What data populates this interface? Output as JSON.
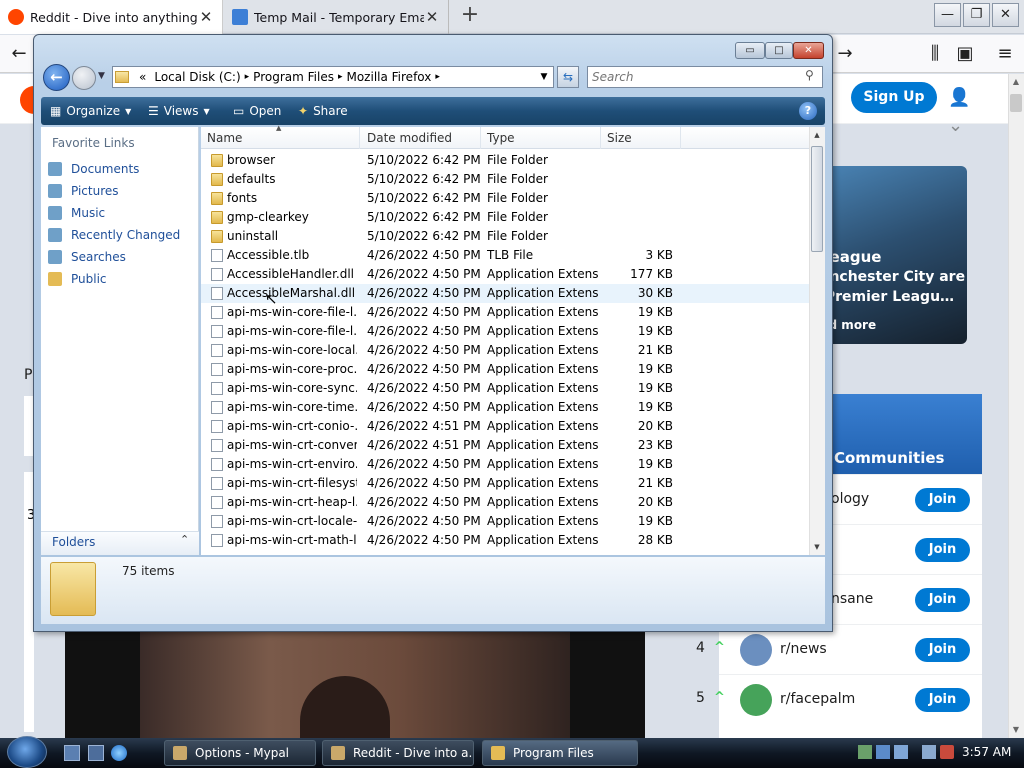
{
  "browser": {
    "tabs": [
      {
        "title": "Reddit - Dive into anything",
        "favicon_color": "#ff4500",
        "active": true
      },
      {
        "title": "Temp Mail - Temporary Email",
        "favicon_color": "#3d7fd6",
        "active": false
      }
    ],
    "new_tab_symbol": "+",
    "window_buttons": {
      "minimize": "—",
      "restore": "❐",
      "close": "✕"
    },
    "nav": {
      "back": "←",
      "forward": "→",
      "library": "⫼",
      "sidebar": "▣",
      "menu": "≡"
    }
  },
  "reddit": {
    "signup_label": "Sign Up",
    "brand_color": "#ff4500",
    "accent_color": "#0079d3",
    "side_letter": "P",
    "side_number": "3",
    "featured": {
      "title": "League",
      "text": "anchester City are\n Premier Leagu…",
      "more": "nd more"
    },
    "communities": {
      "title": "g Communities",
      "rows": [
        {
          "rank": "",
          "name": "ology",
          "icon_color": "#ffffff"
        },
        {
          "rank": "",
          "name": "",
          "icon_color": "#ffffff"
        },
        {
          "rank": "",
          "name": "nsane",
          "icon_color": "#ffffff"
        },
        {
          "rank": "4",
          "name": "r/news",
          "icon_color": "#6b8fbf"
        },
        {
          "rank": "5",
          "name": "r/facepalm",
          "icon_color": "#46a35a"
        }
      ],
      "join_label": "Join",
      "up_arrow": "^"
    }
  },
  "explorer": {
    "caption_buttons": {
      "minimize": "▭",
      "maximize": "□",
      "close": "✕"
    },
    "back_symbol": "←",
    "address": {
      "chevron": "«",
      "segments": [
        "Local Disk (C:)",
        "Program Files",
        "Mozilla Firefox"
      ],
      "separator": "▸"
    },
    "refresh_symbol": "⇆",
    "search_placeholder": "Search",
    "commands": [
      {
        "label": "Organize",
        "icon": "organize-icon",
        "dropdown": true
      },
      {
        "label": "Views",
        "icon": "views-icon",
        "dropdown": true
      },
      {
        "label": "Open",
        "icon": "open-icon",
        "dropdown": false
      },
      {
        "label": "Share",
        "icon": "share-icon",
        "dropdown": false
      }
    ],
    "help_symbol": "?",
    "favorite_links_title": "Favorite Links",
    "favorite_links": [
      {
        "label": "Documents",
        "icon": "documents-icon",
        "color": "#6fa0c8"
      },
      {
        "label": "Pictures",
        "icon": "pictures-icon",
        "color": "#6fa0c8"
      },
      {
        "label": "Music",
        "icon": "music-icon",
        "color": "#6fa0c8"
      },
      {
        "label": "Recently Changed",
        "icon": "recent-icon",
        "color": "#6fa0c8"
      },
      {
        "label": "Searches",
        "icon": "searches-icon",
        "color": "#6fa0c8"
      },
      {
        "label": "Public",
        "icon": "public-folder-icon",
        "color": "#e4bb55"
      }
    ],
    "folders_label": "Folders",
    "folders_toggle": "⌃",
    "columns": [
      "Name",
      "Date modified",
      "Type",
      "Size"
    ],
    "files": [
      {
        "name": "browser",
        "date": "5/10/2022 6:42 PM",
        "type": "File Folder",
        "size": "",
        "kind": "folder"
      },
      {
        "name": "defaults",
        "date": "5/10/2022 6:42 PM",
        "type": "File Folder",
        "size": "",
        "kind": "folder"
      },
      {
        "name": "fonts",
        "date": "5/10/2022 6:42 PM",
        "type": "File Folder",
        "size": "",
        "kind": "folder"
      },
      {
        "name": "gmp-clearkey",
        "date": "5/10/2022 6:42 PM",
        "type": "File Folder",
        "size": "",
        "kind": "folder"
      },
      {
        "name": "uninstall",
        "date": "5/10/2022 6:42 PM",
        "type": "File Folder",
        "size": "",
        "kind": "folder"
      },
      {
        "name": "Accessible.tlb",
        "date": "4/26/2022 4:50 PM",
        "type": "TLB File",
        "size": "3 KB",
        "kind": "file"
      },
      {
        "name": "AccessibleHandler.dll",
        "date": "4/26/2022 4:50 PM",
        "type": "Application Extens...",
        "size": "177 KB",
        "kind": "dll"
      },
      {
        "name": "AccessibleMarshal.dll",
        "date": "4/26/2022 4:50 PM",
        "type": "Application Extens...",
        "size": "30 KB",
        "kind": "dll"
      },
      {
        "name": "api-ms-win-core-file-l...",
        "date": "4/26/2022 4:50 PM",
        "type": "Application Extens...",
        "size": "19 KB",
        "kind": "dll"
      },
      {
        "name": "api-ms-win-core-file-l...",
        "date": "4/26/2022 4:50 PM",
        "type": "Application Extens...",
        "size": "19 KB",
        "kind": "dll"
      },
      {
        "name": "api-ms-win-core-local...",
        "date": "4/26/2022 4:50 PM",
        "type": "Application Extens...",
        "size": "21 KB",
        "kind": "dll"
      },
      {
        "name": "api-ms-win-core-proc...",
        "date": "4/26/2022 4:50 PM",
        "type": "Application Extens...",
        "size": "19 KB",
        "kind": "dll"
      },
      {
        "name": "api-ms-win-core-sync...",
        "date": "4/26/2022 4:50 PM",
        "type": "Application Extens...",
        "size": "19 KB",
        "kind": "dll"
      },
      {
        "name": "api-ms-win-core-time...",
        "date": "4/26/2022 4:50 PM",
        "type": "Application Extens...",
        "size": "19 KB",
        "kind": "dll"
      },
      {
        "name": "api-ms-win-crt-conio-...",
        "date": "4/26/2022 4:51 PM",
        "type": "Application Extens...",
        "size": "20 KB",
        "kind": "dll"
      },
      {
        "name": "api-ms-win-crt-conver...",
        "date": "4/26/2022 4:51 PM",
        "type": "Application Extens...",
        "size": "23 KB",
        "kind": "dll"
      },
      {
        "name": "api-ms-win-crt-enviro...",
        "date": "4/26/2022 4:50 PM",
        "type": "Application Extens...",
        "size": "19 KB",
        "kind": "dll"
      },
      {
        "name": "api-ms-win-crt-filesyst...",
        "date": "4/26/2022 4:50 PM",
        "type": "Application Extens...",
        "size": "21 KB",
        "kind": "dll"
      },
      {
        "name": "api-ms-win-crt-heap-l...",
        "date": "4/26/2022 4:50 PM",
        "type": "Application Extens...",
        "size": "20 KB",
        "kind": "dll"
      },
      {
        "name": "api-ms-win-crt-locale-...",
        "date": "4/26/2022 4:50 PM",
        "type": "Application Extens...",
        "size": "19 KB",
        "kind": "dll"
      },
      {
        "name": "api-ms-win-crt-math-l...",
        "date": "4/26/2022 4:50 PM",
        "type": "Application Extens...",
        "size": "28 KB",
        "kind": "dll"
      }
    ],
    "hovered_row": 7,
    "item_count": "75 items"
  },
  "taskbar": {
    "tasks": [
      {
        "label": "Options - Mypal",
        "icon_color": "#c9a86a"
      },
      {
        "label": "Reddit - Dive into a...",
        "icon_color": "#c9a86a"
      },
      {
        "label": "Program Files",
        "icon_color": "#e4bb55"
      }
    ],
    "clock": "3:57 AM"
  }
}
